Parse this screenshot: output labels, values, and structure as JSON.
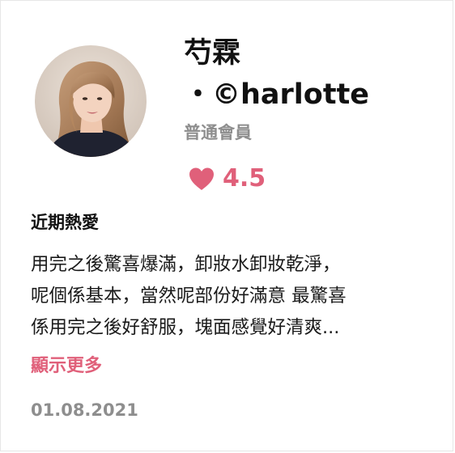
{
  "profile": {
    "name_line1": "芍霖",
    "name_line2": "・©harlotte",
    "member_level": "普通會員",
    "rating": "4.5"
  },
  "review": {
    "section_title": "近期熱愛",
    "text_lines": [
      "用完之後驚喜爆滿，卸妝水卸妝乾淨，",
      "呢個係基本，當然呢部份好滿意 最驚喜",
      "係用完之後好舒服，塊面感覺好清爽..."
    ],
    "show_more_label": "顯示更多",
    "date": "01.08.2021"
  },
  "colors": {
    "accent": "#e0607a",
    "muted": "#8e8e8e",
    "text": "#111111"
  },
  "icons": {
    "rating": "heart-icon",
    "avatar": "user-avatar-photo"
  }
}
